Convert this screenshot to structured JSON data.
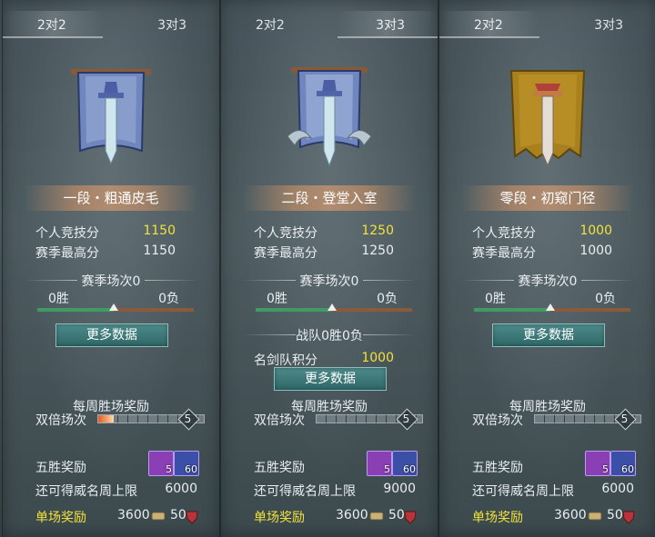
{
  "tabs": {
    "two_v_two": "2对2",
    "three_v_three": "3对3"
  },
  "labels": {
    "personal_score": "个人竞技分",
    "season_high": "赛季最高分",
    "season_matches": "赛季场次0",
    "wins": "0胜",
    "losses": "0负",
    "more_data": "更多数据",
    "weekly_reward": "每周胜场奖励",
    "double_matches": "双倍场次",
    "five_win_reward": "五胜奖励",
    "prestige_cap": "还可得威名周上限",
    "single_reward": "单场奖励",
    "team_record": "战队0胜0负",
    "team_score_label": "名剑队积分"
  },
  "panels": [
    {
      "rank": "一段・粗通皮毛",
      "personal_score": "1150",
      "season_high": "1150",
      "double_count": "5",
      "scroll_count": "5",
      "stone_count": "60",
      "prestige_cap": "6000",
      "coin_reward": "3600",
      "shield_reward": "50",
      "progress": 0.15
    },
    {
      "rank": "二段・登堂入室",
      "personal_score": "1250",
      "season_high": "1250",
      "team_score": "1000",
      "double_count": "5",
      "scroll_count": "5",
      "stone_count": "60",
      "prestige_cap": "9000",
      "coin_reward": "3600",
      "shield_reward": "50",
      "progress": 0
    },
    {
      "rank": "零段・初窥门径",
      "personal_score": "1000",
      "season_high": "1000",
      "double_count": "5",
      "scroll_count": "5",
      "stone_count": "60",
      "prestige_cap": "6000",
      "coin_reward": "3600",
      "shield_reward": "50",
      "progress": 0
    }
  ],
  "icons": {
    "emblem_blue": "blue-sword-banner-icon",
    "emblem_ornate": "ornate-sword-banner-icon",
    "emblem_gold": "gold-sword-banner-icon",
    "scroll": "reward-scroll-icon",
    "stone": "reward-stone-icon",
    "coin": "coin-icon",
    "shield": "shield-icon"
  },
  "colors": {
    "highlight": "#f2e23b",
    "win_bar": "#3f9a63",
    "loss_bar": "#8a5a3e",
    "button": "#2f6767"
  }
}
